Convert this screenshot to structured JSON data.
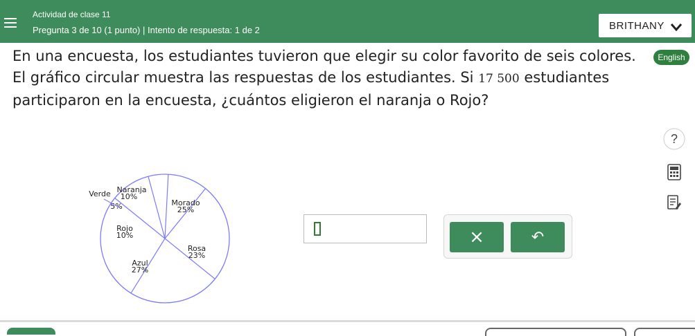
{
  "header": {
    "activity_title": "Actividad de clase 11",
    "progress": "Pregunta 3 de 10 (1 punto)  |  Intento de respuesta: 1 de 2",
    "user_name": "BRITHANY",
    "bg_color": "#3e8b5c"
  },
  "language_button": "English",
  "question": {
    "text_before": "En una encuesta, los estudiantes tuvieron que elegir su color favorito de seis colores. El gráfico circular muestra las respuestas de los estudiantes. Si ",
    "number": "17 500",
    "text_after": " estudiantes participaron en la encuesta, ¿cuántos eligieron el naranja o Rojo?"
  },
  "side_tools": [
    "help-icon",
    "calculator-icon",
    "notes-icon"
  ],
  "side_help_glyph": "?",
  "answer": {
    "value": ""
  },
  "buttons": {
    "clear_glyph": "×",
    "undo_glyph": "↶"
  },
  "chart_data": {
    "type": "pie",
    "slices": [
      {
        "name": "Naranja",
        "percent": "10%",
        "value": 10
      },
      {
        "name": "Morado",
        "percent": "25%",
        "value": 25
      },
      {
        "name": "Rosa",
        "percent": "23%",
        "value": 23
      },
      {
        "name": "Azul",
        "percent": "27%",
        "value": 27
      },
      {
        "name": "Rojo",
        "percent": "10%",
        "value": 10
      },
      {
        "name": "Verde",
        "percent": "5%",
        "value": 5
      }
    ],
    "stroke_color": "#7b7bff"
  }
}
